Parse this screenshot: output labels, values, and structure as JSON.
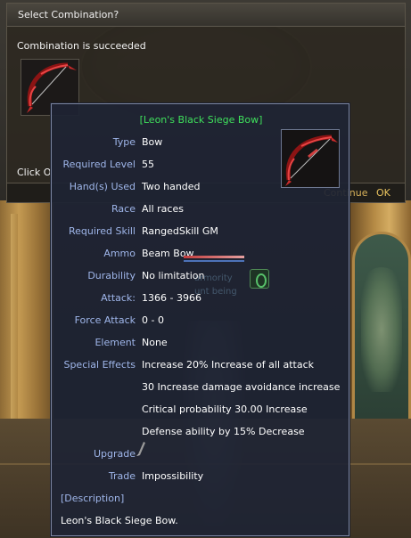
{
  "dialog": {
    "title": "Select Combination?",
    "message": "Combination is succeeded",
    "click_prefix": "Click O",
    "continue_label": "Continue",
    "ok_label": "OK"
  },
  "tooltip": {
    "title": "[Leon's Black Siege Bow]",
    "rows": [
      {
        "label": "Type",
        "value": "Bow"
      },
      {
        "label": "Required Level",
        "value": "55"
      },
      {
        "label": "Hand(s) Used",
        "value": "Two handed"
      },
      {
        "label": "Race",
        "value": "All races"
      },
      {
        "label": "Required Skill",
        "value": "RangedSkill GM"
      },
      {
        "label": "Ammo",
        "value": "Beam Bow"
      },
      {
        "label": "Durability",
        "value": "No limitation"
      },
      {
        "label": "Attack:",
        "value": "1366 - 3966"
      },
      {
        "label": "Force Attack",
        "value": "0 - 0"
      },
      {
        "label": "Element",
        "value": "None"
      },
      {
        "label": "Special Effects",
        "value": "Increase 20% Increase of all attack"
      }
    ],
    "effects_extra": [
      "30 Increase damage avoidance increase",
      "Critical probability 30.00 Increase",
      "Defense ability by 15% Decrease"
    ],
    "upgrade_label": "Upgrade",
    "trade_label": "Trade",
    "trade_value": "Impossibility",
    "description_header": "[Description]",
    "description_text": "Leon's Black Siege Bow.",
    "ghost_text_1": "armority",
    "ghost_text_2": "unt being"
  },
  "colors": {
    "title_green": "#3fe05c",
    "label_blue": "#9fb6ea",
    "ok_gold": "#e8c25e"
  }
}
